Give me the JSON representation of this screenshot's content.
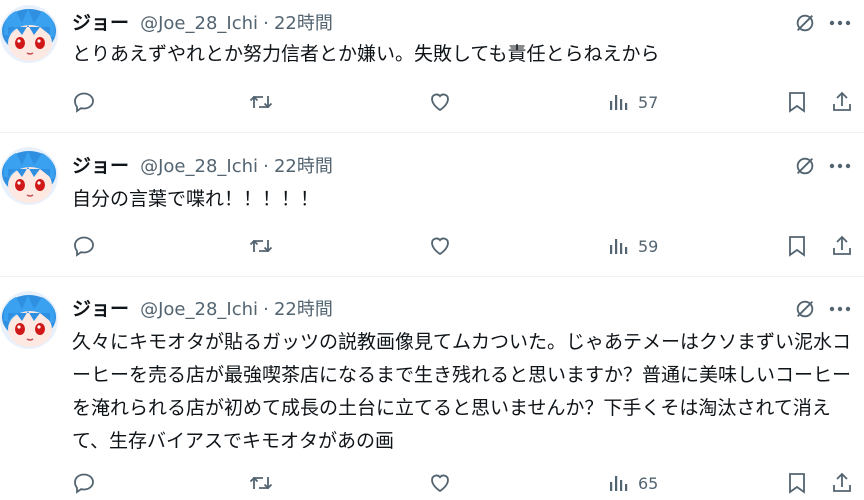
{
  "tweets": [
    {
      "name": "ジョー",
      "handle": "@Joe_28_Ichi",
      "sep": "·",
      "time": "22時間",
      "text": "とりあえずやれとか努力信者とか嫌い。失敗しても責任とらねえから",
      "views": "57"
    },
    {
      "name": "ジョー",
      "handle": "@Joe_28_Ichi",
      "sep": "·",
      "time": "22時間",
      "text": "自分の言葉で喋れ！！！！！",
      "views": "59"
    },
    {
      "name": "ジョー",
      "handle": "@Joe_28_Ichi",
      "sep": "·",
      "time": "22時間",
      "text": "久々にキモオタが貼るガッツの説教画像見てムカついた。じゃあテメーはクソまずい泥水コーヒーを売る店が最強喫茶店になるまで生き残れると思いますか？普通に美味しいコーヒーを淹れられる店が初めて成長の土台に立てると思いませんか？下手くそは淘汰されて消えて、生存バイアスでキモオタがあの画",
      "views": "65"
    }
  ],
  "icons": {
    "reply": "reply-icon",
    "retweet": "retweet-icon",
    "like": "like-icon",
    "views": "views-icon",
    "bookmark": "bookmark-icon",
    "share": "share-icon",
    "grok": "grok-icon",
    "more": "more-icon"
  },
  "colors": {
    "icon": "#536471",
    "text": "#0f1419",
    "avatar_hair": "#2f8fe0",
    "avatar_eye": "#d01818"
  }
}
